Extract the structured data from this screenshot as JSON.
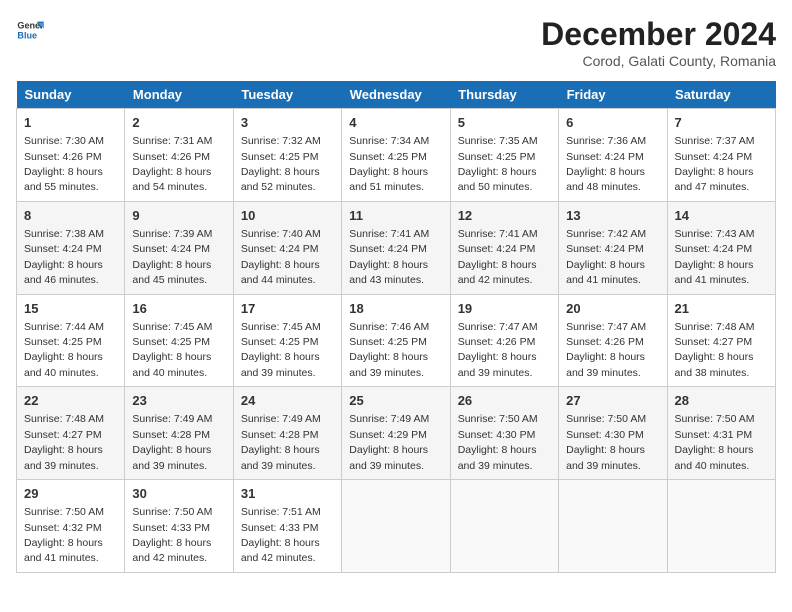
{
  "logo": {
    "line1": "General",
    "line2": "Blue"
  },
  "title": "December 2024",
  "subtitle": "Corod, Galati County, Romania",
  "weekdays": [
    "Sunday",
    "Monday",
    "Tuesday",
    "Wednesday",
    "Thursday",
    "Friday",
    "Saturday"
  ],
  "weeks": [
    [
      {
        "day": 1,
        "sunrise": "7:30 AM",
        "sunset": "4:26 PM",
        "daylight": "8 hours and 55 minutes."
      },
      {
        "day": 2,
        "sunrise": "7:31 AM",
        "sunset": "4:26 PM",
        "daylight": "8 hours and 54 minutes."
      },
      {
        "day": 3,
        "sunrise": "7:32 AM",
        "sunset": "4:25 PM",
        "daylight": "8 hours and 52 minutes."
      },
      {
        "day": 4,
        "sunrise": "7:34 AM",
        "sunset": "4:25 PM",
        "daylight": "8 hours and 51 minutes."
      },
      {
        "day": 5,
        "sunrise": "7:35 AM",
        "sunset": "4:25 PM",
        "daylight": "8 hours and 50 minutes."
      },
      {
        "day": 6,
        "sunrise": "7:36 AM",
        "sunset": "4:24 PM",
        "daylight": "8 hours and 48 minutes."
      },
      {
        "day": 7,
        "sunrise": "7:37 AM",
        "sunset": "4:24 PM",
        "daylight": "8 hours and 47 minutes."
      }
    ],
    [
      {
        "day": 8,
        "sunrise": "7:38 AM",
        "sunset": "4:24 PM",
        "daylight": "8 hours and 46 minutes."
      },
      {
        "day": 9,
        "sunrise": "7:39 AM",
        "sunset": "4:24 PM",
        "daylight": "8 hours and 45 minutes."
      },
      {
        "day": 10,
        "sunrise": "7:40 AM",
        "sunset": "4:24 PM",
        "daylight": "8 hours and 44 minutes."
      },
      {
        "day": 11,
        "sunrise": "7:41 AM",
        "sunset": "4:24 PM",
        "daylight": "8 hours and 43 minutes."
      },
      {
        "day": 12,
        "sunrise": "7:41 AM",
        "sunset": "4:24 PM",
        "daylight": "8 hours and 42 minutes."
      },
      {
        "day": 13,
        "sunrise": "7:42 AM",
        "sunset": "4:24 PM",
        "daylight": "8 hours and 41 minutes."
      },
      {
        "day": 14,
        "sunrise": "7:43 AM",
        "sunset": "4:24 PM",
        "daylight": "8 hours and 41 minutes."
      }
    ],
    [
      {
        "day": 15,
        "sunrise": "7:44 AM",
        "sunset": "4:25 PM",
        "daylight": "8 hours and 40 minutes."
      },
      {
        "day": 16,
        "sunrise": "7:45 AM",
        "sunset": "4:25 PM",
        "daylight": "8 hours and 40 minutes."
      },
      {
        "day": 17,
        "sunrise": "7:45 AM",
        "sunset": "4:25 PM",
        "daylight": "8 hours and 39 minutes."
      },
      {
        "day": 18,
        "sunrise": "7:46 AM",
        "sunset": "4:25 PM",
        "daylight": "8 hours and 39 minutes."
      },
      {
        "day": 19,
        "sunrise": "7:47 AM",
        "sunset": "4:26 PM",
        "daylight": "8 hours and 39 minutes."
      },
      {
        "day": 20,
        "sunrise": "7:47 AM",
        "sunset": "4:26 PM",
        "daylight": "8 hours and 39 minutes."
      },
      {
        "day": 21,
        "sunrise": "7:48 AM",
        "sunset": "4:27 PM",
        "daylight": "8 hours and 38 minutes."
      }
    ],
    [
      {
        "day": 22,
        "sunrise": "7:48 AM",
        "sunset": "4:27 PM",
        "daylight": "8 hours and 39 minutes."
      },
      {
        "day": 23,
        "sunrise": "7:49 AM",
        "sunset": "4:28 PM",
        "daylight": "8 hours and 39 minutes."
      },
      {
        "day": 24,
        "sunrise": "7:49 AM",
        "sunset": "4:28 PM",
        "daylight": "8 hours and 39 minutes."
      },
      {
        "day": 25,
        "sunrise": "7:49 AM",
        "sunset": "4:29 PM",
        "daylight": "8 hours and 39 minutes."
      },
      {
        "day": 26,
        "sunrise": "7:50 AM",
        "sunset": "4:30 PM",
        "daylight": "8 hours and 39 minutes."
      },
      {
        "day": 27,
        "sunrise": "7:50 AM",
        "sunset": "4:30 PM",
        "daylight": "8 hours and 39 minutes."
      },
      {
        "day": 28,
        "sunrise": "7:50 AM",
        "sunset": "4:31 PM",
        "daylight": "8 hours and 40 minutes."
      }
    ],
    [
      {
        "day": 29,
        "sunrise": "7:50 AM",
        "sunset": "4:32 PM",
        "daylight": "8 hours and 41 minutes."
      },
      {
        "day": 30,
        "sunrise": "7:50 AM",
        "sunset": "4:33 PM",
        "daylight": "8 hours and 42 minutes."
      },
      {
        "day": 31,
        "sunrise": "7:51 AM",
        "sunset": "4:33 PM",
        "daylight": "8 hours and 42 minutes."
      },
      null,
      null,
      null,
      null
    ]
  ]
}
